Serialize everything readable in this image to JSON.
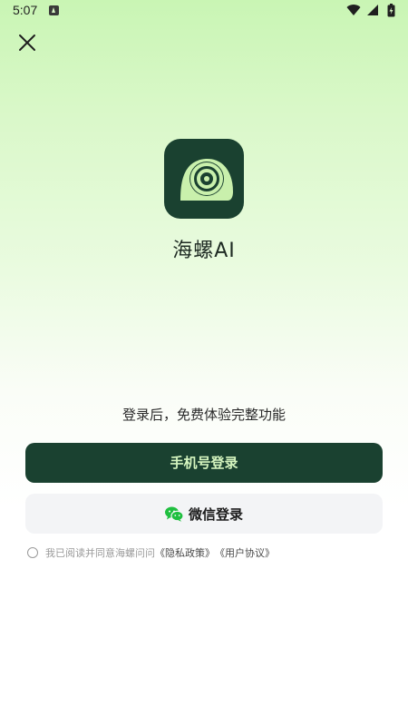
{
  "status_bar": {
    "time": "5:07"
  },
  "icons": {
    "close": "close-icon",
    "logo": "snail-logo-icon",
    "wechat": "wechat-icon",
    "wifi": "wifi-icon",
    "signal": "signal-icon",
    "battery": "battery-icon"
  },
  "app": {
    "name": "海螺AI",
    "tagline": "登录后，免费体验完整功能"
  },
  "buttons": {
    "phone_login": "手机号登录",
    "wechat_login": "微信登录"
  },
  "agreement": {
    "prefix": "我已阅读并同意海螺问问",
    "privacy_policy": "《隐私政策》",
    "user_agreement": "《用户协议》"
  },
  "colors": {
    "brand_dark": "#1a4130",
    "brand_light": "#d5f5bf",
    "wechat_green": "#1fbf3f"
  }
}
